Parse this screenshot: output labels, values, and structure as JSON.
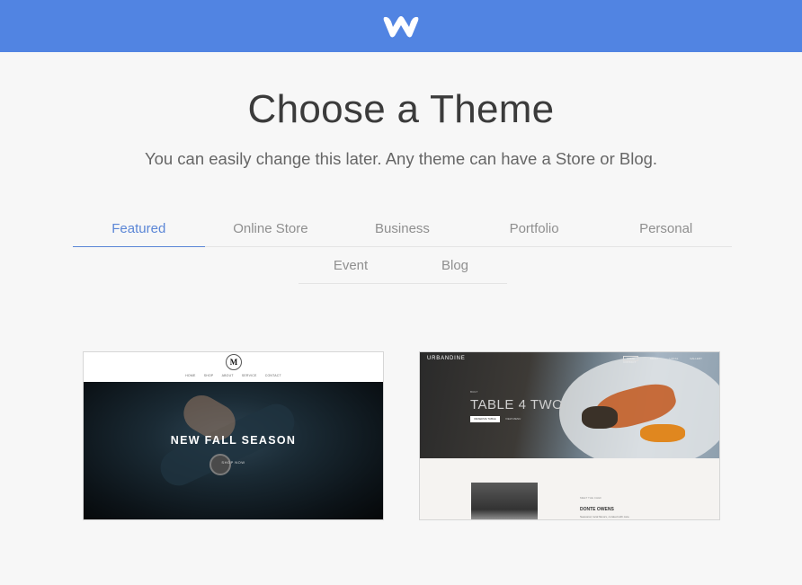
{
  "header": {
    "logo_icon": "weebly-w-logo",
    "brand_color": "#5184e2"
  },
  "page": {
    "title": "Choose a Theme",
    "subtitle": "You can easily change this later. Any theme can have a Store or Blog."
  },
  "tabs": {
    "active": "Featured",
    "row1": [
      "Featured",
      "Online Store",
      "Business",
      "Portfolio",
      "Personal"
    ],
    "row2": [
      "Event",
      "Blog"
    ],
    "active_color": "#5b86d6"
  },
  "themes": [
    {
      "logo_letter": "M",
      "nav": [
        "HOME",
        "SHOP",
        "ABOUT",
        "SERVICE",
        "CONTACT"
      ],
      "headline": "NEW FALL SEASON",
      "button": "SHOP NOW"
    },
    {
      "brand": "URBANDINE",
      "nav": [
        "HOME",
        "MENU",
        "LOCAL",
        "GALLERY",
        "CONTACT"
      ],
      "eyebrow": "BUILT",
      "heading": "TABLE 4 TWO",
      "button_primary": "RESERVE TABLE",
      "button_secondary": "VIEW MENU",
      "chef_label": "MEET THE CHEF",
      "chef_name": "DONTE OWENS",
      "chef_text": "Seasonal, local flavors, curated with care."
    }
  ]
}
